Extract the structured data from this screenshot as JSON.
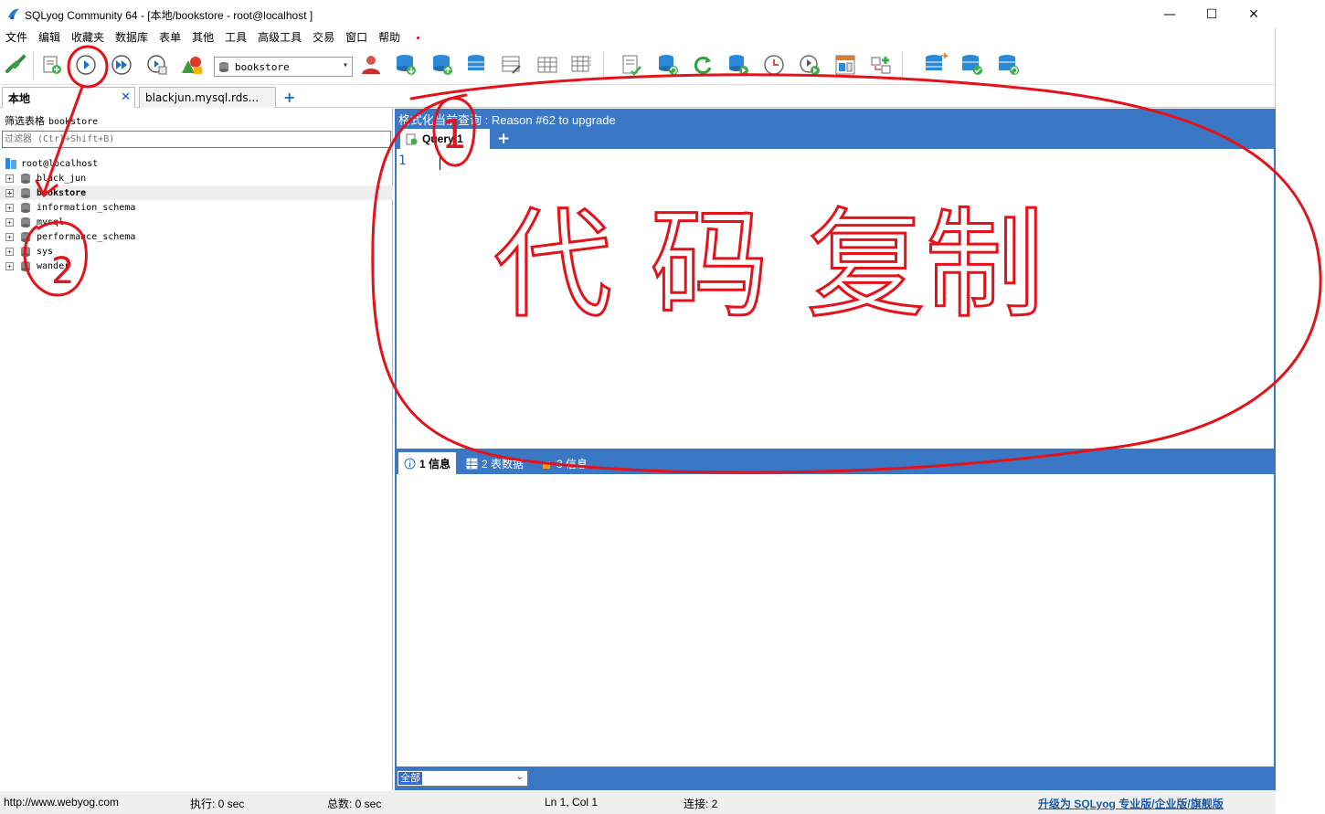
{
  "window": {
    "title": "SQLyog Community 64 - [本地/bookstore - root@localhost ]",
    "controls": {
      "minimize": "—",
      "maximize": "☐",
      "close": "✕"
    }
  },
  "menu": [
    "文件",
    "编辑",
    "收藏夹",
    "数据库",
    "表单",
    "其他",
    "工具",
    "高级工具",
    "交易",
    "窗口",
    "帮助"
  ],
  "toolbar": {
    "database_selected": "bookstore",
    "icons": [
      "new-connection-icon",
      "new-query-icon",
      "execute-query-icon",
      "execute-all-icon",
      "execute-edit-icon",
      "schema-designer-icon",
      "user-manager-icon",
      "backup-icon",
      "restore-icon",
      "import-icon",
      "table-diagnostics-icon",
      "sync-icon",
      "refresh-icon",
      "copy-database-icon",
      "scheduled-jobs-icon",
      "data-sync-icon",
      "query-builder-icon",
      "schema-sync-icon"
    ]
  },
  "connection_tabs": [
    {
      "label": "本地",
      "active": true,
      "close": "✕"
    },
    {
      "label": "blackjun.mysql.rds...",
      "active": false
    }
  ],
  "connection_add": "+",
  "left": {
    "filter_label": "筛选表格",
    "filter_value": "bookstore",
    "filter_placeholder": "过滤器 (Ctrl+Shift+B)",
    "root": "root@localhost",
    "databases": [
      {
        "name": "black_jun",
        "selected": false
      },
      {
        "name": "bookstore",
        "selected": true
      },
      {
        "name": "information_schema",
        "selected": false
      },
      {
        "name": "mysql",
        "selected": false
      },
      {
        "name": "performance_schema",
        "selected": false
      },
      {
        "name": "sys",
        "selected": false
      },
      {
        "name": "wander",
        "selected": false
      }
    ],
    "expander_symbol": "+"
  },
  "right": {
    "upgrade_text": "格式化当前查询 : Reason #62 to upgrade",
    "query_tab": "Query 1",
    "query_add": "+",
    "line_number": "1",
    "result_tabs": [
      "1 信息",
      "2 表数据",
      "3 信息"
    ],
    "bottom_filter": "全部"
  },
  "status": {
    "url": "http://www.webyog.com",
    "exec": "执行: 0 sec",
    "total": "总数: 0 sec",
    "position": "Ln 1, Col 1",
    "connections": "连接: 2",
    "upgrade_link": "升级为 SQLyog 专业版/企业版/旗舰版"
  },
  "annotations": {
    "circle_1_label": "1",
    "circle_2_label": "2",
    "handwriting": "代 码 复制"
  },
  "colors": {
    "accent_blue": "#3a78c6",
    "annotation_red": "#e3121b"
  }
}
